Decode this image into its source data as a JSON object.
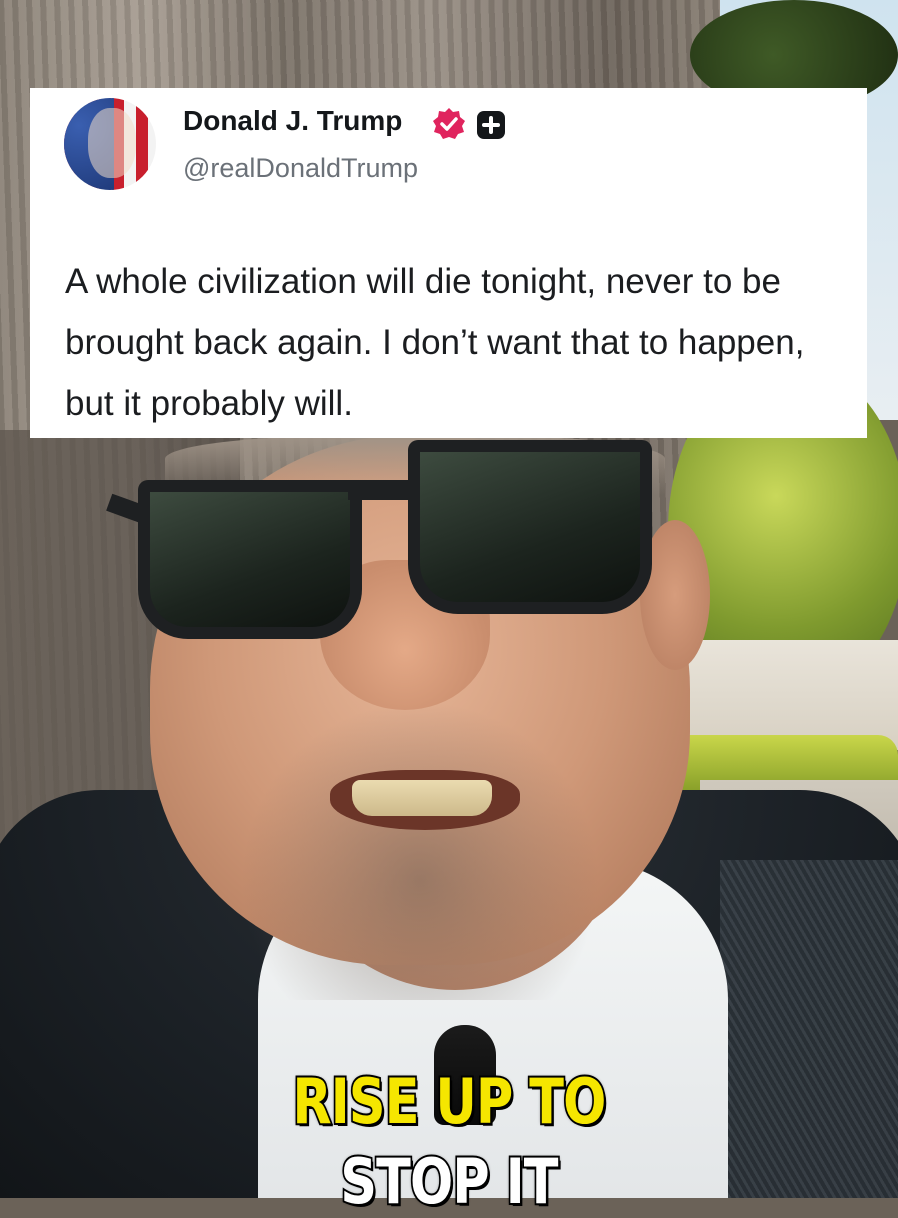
{
  "tweet": {
    "author_name": "Donald J. Trump",
    "handle": "@realDonaldTrump",
    "text": "A whole civilization will die tonight, never to be brought back again. I don’t want that to happen, but it probably will.",
    "verified_color": "#e0245e"
  },
  "caption": {
    "line_1": "RISE UP TO",
    "line_2": "STOP IT",
    "line_1_color": "#f5e600",
    "line_2_color": "#ffffff"
  }
}
